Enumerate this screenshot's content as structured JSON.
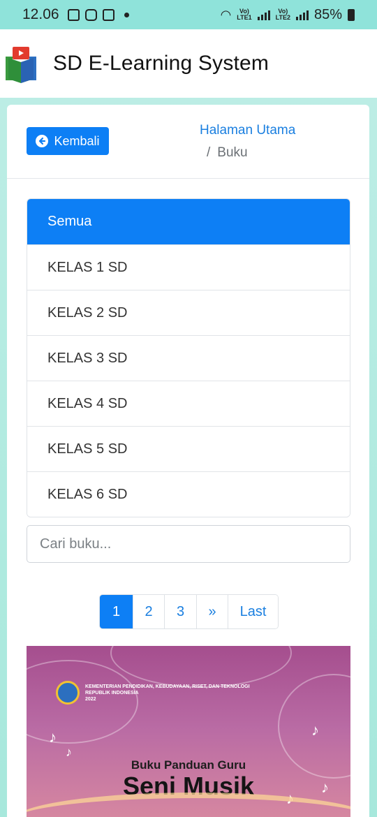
{
  "status_bar": {
    "time": "12.06",
    "battery": "85%",
    "sim1": "LTE1",
    "sim2": "LTE2"
  },
  "app": {
    "title": "SD E-Learning System"
  },
  "toolbar": {
    "back_label": "Kembali"
  },
  "breadcrumb": {
    "home": "Halaman Utama",
    "separator": "/",
    "current": "Buku"
  },
  "categories": [
    {
      "label": "Semua",
      "active": true
    },
    {
      "label": "KELAS 1 SD",
      "active": false
    },
    {
      "label": "KELAS 2 SD",
      "active": false
    },
    {
      "label": "KELAS 3 SD",
      "active": false
    },
    {
      "label": "KELAS 4 SD",
      "active": false
    },
    {
      "label": "KELAS 5 SD",
      "active": false
    },
    {
      "label": "KELAS 6 SD",
      "active": false
    }
  ],
  "search": {
    "placeholder": "Cari buku...",
    "value": ""
  },
  "pagination": {
    "pages": [
      "1",
      "2",
      "3"
    ],
    "active_page": "1",
    "next": "»",
    "last": "Last"
  },
  "book": {
    "publisher_line1": "KEMENTERIAN PENDIDIKAN, KEBUDAYAAN, RISET, DAN TEKNOLOGI",
    "publisher_line2": "REPUBLIK INDONESIA",
    "year": "2022",
    "subtitle": "Buku Panduan Guru",
    "title": "Seni Musik"
  },
  "colors": {
    "accent": "#0d7ff5",
    "link": "#1a7fe0",
    "background": "#a7e8dc",
    "status_bar": "#8fe3da"
  }
}
